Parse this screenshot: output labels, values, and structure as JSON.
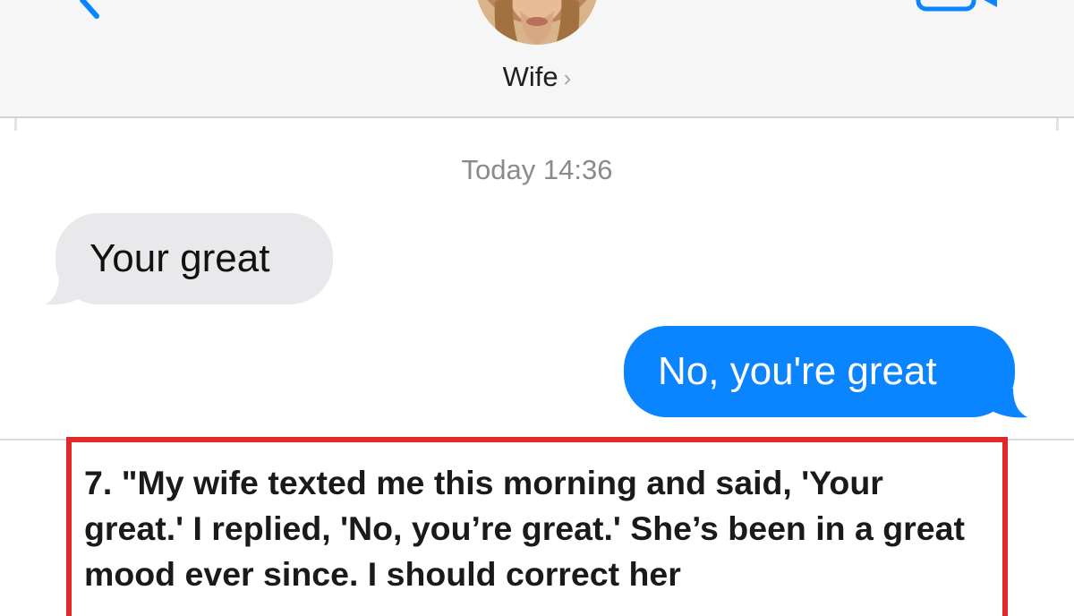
{
  "header": {
    "contact_name": "Wife",
    "contact_chevron": "›",
    "icons": {
      "back": "chevron-left-icon",
      "video": "video-camera-icon",
      "avatar": "avatar"
    }
  },
  "conversation": {
    "timestamp": "Today 14:36",
    "messages": [
      {
        "direction": "incoming",
        "text": "Your great"
      },
      {
        "direction": "outgoing",
        "text": "No, you're great"
      }
    ]
  },
  "caption": {
    "text": "7. \"My wife texted me this morning and said, 'Your great.' I replied, 'No, you’re great.' She’s been in a great mood ever since. I should correct her"
  },
  "colors": {
    "accent_blue": "#0a84ff",
    "incoming_bubble": "#e9e9eb",
    "caption_border": "#e2292a"
  }
}
